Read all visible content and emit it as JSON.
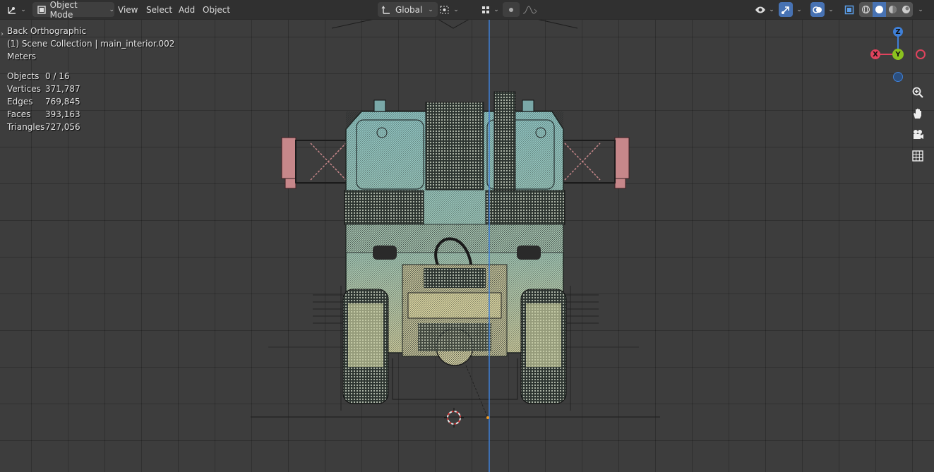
{
  "header": {
    "mode_label": "Object Mode",
    "menus": [
      "View",
      "Select",
      "Add",
      "Object"
    ],
    "transform_orientation": "Global"
  },
  "overlay": {
    "view_name": "Back Orthographic",
    "collection": "(1) Scene Collection | main_interior.002",
    "units": "Meters"
  },
  "stats": [
    {
      "label": "Objects",
      "value": "0 / 16"
    },
    {
      "label": "Vertices",
      "value": "371,787"
    },
    {
      "label": "Edges",
      "value": "769,845"
    },
    {
      "label": "Faces",
      "value": "393,163"
    },
    {
      "label": "Triangles",
      "value": "727,056"
    }
  ],
  "gizmo": {
    "z_label": "Z",
    "x_label": "X",
    "y_label": "Y",
    "colors": {
      "x": "#e0435d",
      "y": "#8bc21f",
      "z": "#3f80d8"
    }
  },
  "nav_icons": [
    "zoom-icon",
    "hand-icon",
    "camera-icon",
    "grid-icon"
  ]
}
